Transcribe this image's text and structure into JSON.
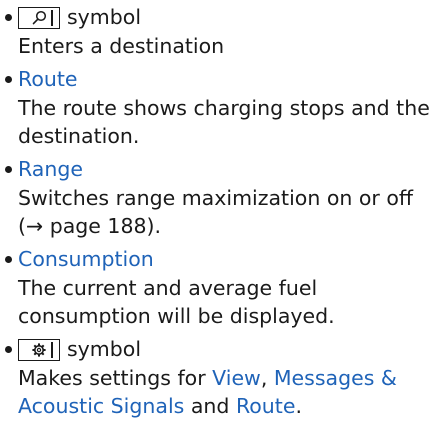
{
  "items": [
    {
      "heading_suffix": "symbol",
      "icon": "search-icon",
      "description": "Enters a destination"
    },
    {
      "heading": "Route",
      "description": "The route shows charging stops and the destination."
    },
    {
      "heading": "Range",
      "description": "Switches range maximization on or off (→ page 188)."
    },
    {
      "heading": "Consumption",
      "description": "The current and average fuel consumption will be displayed."
    },
    {
      "heading_suffix": "symbol",
      "icon": "gear-icon",
      "description_parts": [
        {
          "text": "Makes settings for ",
          "link": false
        },
        {
          "text": "View",
          "link": true
        },
        {
          "text": ", ",
          "link": false
        },
        {
          "text": "Messages & Acoustic Signals",
          "link": true
        },
        {
          "text": " and ",
          "link": false
        },
        {
          "text": "Route",
          "link": true
        },
        {
          "text": ".",
          "link": false
        }
      ]
    }
  ],
  "colors": {
    "text": "#1a1a1a",
    "accent_blue": "#1f63b8"
  }
}
